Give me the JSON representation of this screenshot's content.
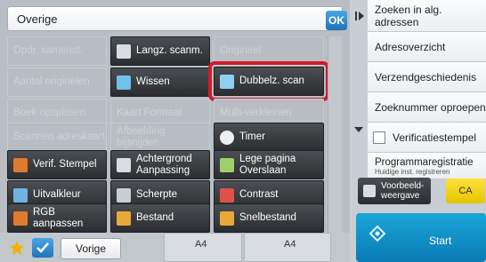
{
  "title": "Overige",
  "ok_label": "OK",
  "grid": {
    "r0": [
      "Opdr. samenst.",
      "Langz. scanm.",
      "Origineel"
    ],
    "r1": [
      "Aantal originelen",
      "Wissen",
      "Dubbelz. scan"
    ],
    "r2": [
      "Boek opsplitsen",
      "Kaart Formaat",
      "Multi-verkleinen"
    ],
    "r3": [
      "Scannen adreskaart",
      "Afbeelding bijsnijden",
      "Timer"
    ],
    "r4": [
      "Verif. Stempel",
      "Achtergrond Aanpassing",
      "Lege pagina Overslaan"
    ],
    "r5": [
      "Uitvalkleur",
      "Scherpte",
      "Contrast"
    ],
    "r6": [
      "RGB aanpassen",
      "Bestand",
      "Snelbestand"
    ]
  },
  "bottom": {
    "prev_label": "Vorige",
    "paper_a": "A4",
    "paper_b": "A4"
  },
  "sidebar": {
    "items": [
      "Zoeken in alg. adressen",
      "Adresoverzicht",
      "Verzendgeschiedenis",
      "Zoeknummer oproepen",
      "Verificatiestempel"
    ],
    "prog_title": "Programmaregistratie",
    "prog_sub": "Huidige inst. registreren"
  },
  "preview_label": "Voorbeeld-weergave",
  "ca_label": "CA",
  "start_label": "Start",
  "colors": {
    "accent_red": "#d31a2a",
    "start_blue": "#0a7ab5",
    "ca_yellow": "#f2d200"
  }
}
